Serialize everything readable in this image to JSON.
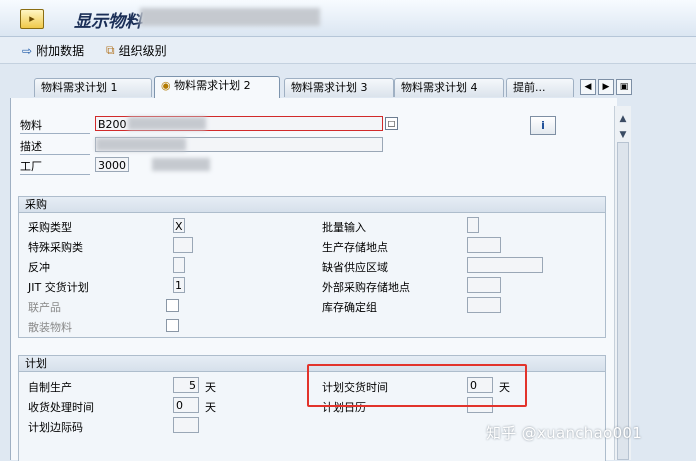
{
  "window": {
    "title": "显示物料"
  },
  "toolbar": {
    "additional_data": "附加数据",
    "org_levels": "组织级别"
  },
  "tabs": [
    "物料需求计划 1",
    "物料需求计划 2",
    "物料需求计划 3",
    "物料需求计划 4",
    "提前..."
  ],
  "header": {
    "material_label": "物料",
    "material_value": "B200",
    "desc_label": "描述",
    "plant_label": "工厂",
    "plant_value": "3000"
  },
  "procurement": {
    "title": "采购",
    "proc_type_label": "采购类型",
    "proc_type_value": "X",
    "special_proc_label": "特殊采购类",
    "backflush_label": "反冲",
    "jit_label": "JIT 交货计划",
    "jit_value": "1",
    "coproduct_label": "联产品",
    "bulk_label": "散装物料",
    "batch_entry_label": "批量输入",
    "prod_stor_label": "生产存储地点",
    "default_supply_label": "缺省供应区域",
    "ext_stor_label": "外部采购存储地点",
    "stor_bin_label": "库存确定组"
  },
  "scheduling": {
    "title": "计划",
    "inhouse_label": "自制生产",
    "inhouse_value": "5",
    "inhouse_unit": "天",
    "gr_time_label": "收货处理时间",
    "gr_time_value": "0",
    "gr_time_unit": "天",
    "margin_key_label": "计划边际码",
    "pdt_label": "计划交货时间",
    "pdt_value": "0",
    "pdt_unit": "天",
    "calendar_label": "计划日历"
  },
  "watermark": "知乎 @xuanchao001"
}
